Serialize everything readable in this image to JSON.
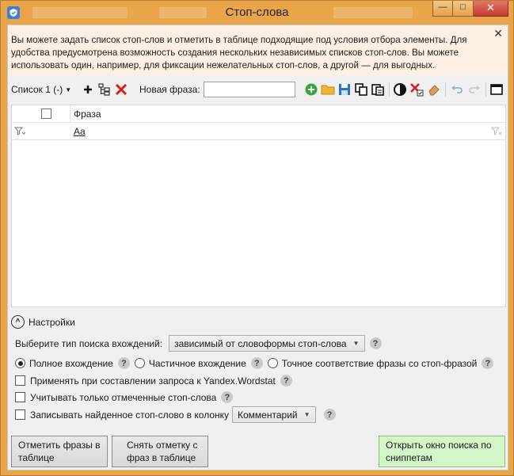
{
  "window": {
    "title": "Стоп-слова",
    "controls": {
      "minimize": "—",
      "maximize": "□",
      "close": "✕"
    }
  },
  "info": {
    "text_line1": "Вы можете задать список стоп-слов и отметить в таблице подходящие под условия отбора элементы. Для",
    "text_line2": "удобства предусмотрена возможность создания нескольких независимых списков стоп-слов. Вы можете",
    "text_line3": "использовать один, например, для фиксации нежелательных стоп-слов, а другой — для выгодных.",
    "close": "✕"
  },
  "toolbar": {
    "list_select": "Список 1 (-)",
    "new_phrase_label": "Новая фраза:",
    "new_phrase_value": "",
    "icons": [
      "add-icon",
      "tree-icon",
      "delete-icon",
      "add-green-icon",
      "folder-icon",
      "save-icon",
      "copy-icon",
      "paste-icon",
      "contrast-icon",
      "clear-checked-icon",
      "eraser-icon",
      "undo-icon",
      "redo-icon",
      "window-icon"
    ]
  },
  "grid": {
    "columns": [
      "Фраза"
    ],
    "filter_text": "Aa",
    "rows": []
  },
  "settings": {
    "toggle_label": "Настройки",
    "search_type_label": "Выберите тип поиска вхождений:",
    "search_type_value": "зависимый от словоформы стоп-слова",
    "radio_full": "Полное вхождение",
    "radio_partial": "Частичное вхождение",
    "radio_exact": "Точное соответствие фразы со стоп-фразой",
    "check_wordstat": "Применять при составлении запроса к Yandex.Wordstat",
    "check_marked": "Учитывать только отмеченные стоп-слова",
    "check_write_col": "Записывать найденное стоп-слово в колонку",
    "column_value": "Комментарий",
    "help": "?"
  },
  "buttons": {
    "mark_line1": "Отметить фразы в",
    "mark_line2": "таблице",
    "unmark_line1": "Снять отметку с",
    "unmark_line2": "фраз в таблице",
    "snippets_line1": "Открыть окно поиска по",
    "snippets_line2": "сниппетам"
  },
  "colors": {
    "titlebar": "#e9a54a",
    "info_bg": "#fdf0e2",
    "green_button": "#d3f5c8"
  }
}
